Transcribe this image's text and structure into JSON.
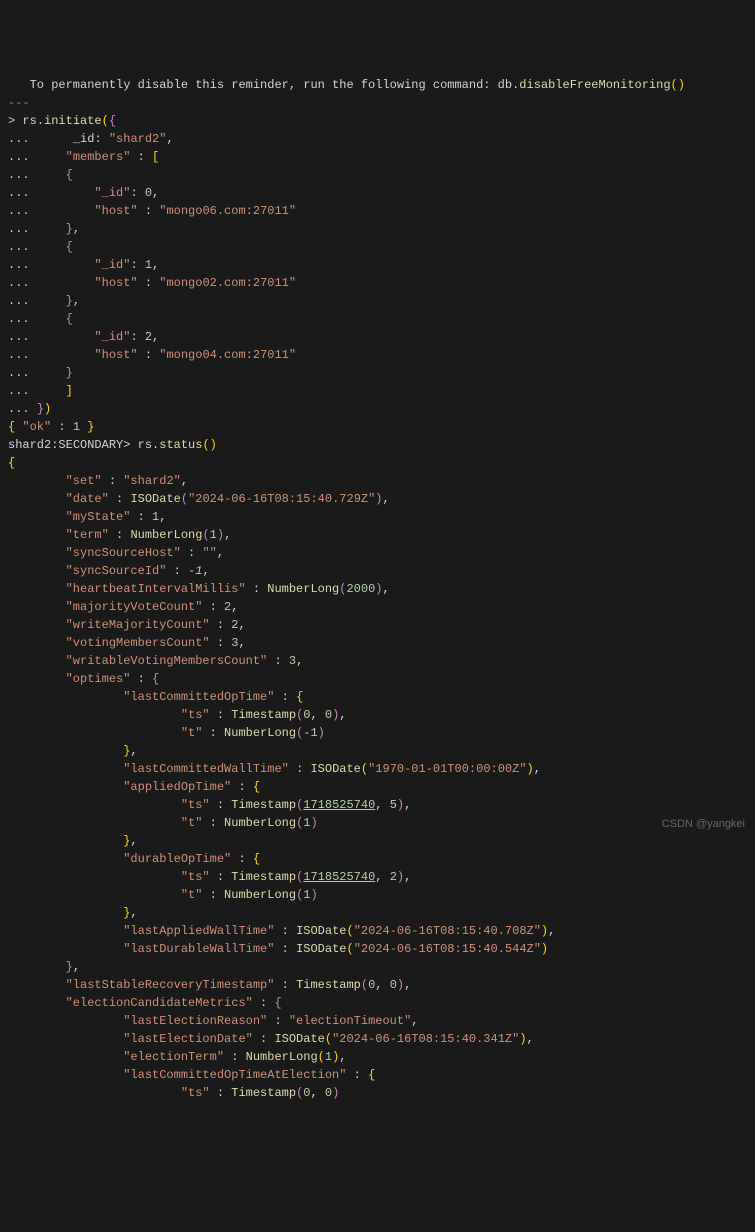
{
  "line1": {
    "text1": "   To permanently disable this reminder, run the following command",
    "colon": ":",
    "db": " db",
    "dot": ".",
    "fn": "disableFreeMonitoring",
    "parens": "()"
  },
  "dashes": "---",
  "prompt": {
    "gt": ">",
    "rs": " rs",
    "dot": ".",
    "initiate": "initiate",
    "paren_open": "(",
    "brace_open": "{"
  },
  "initiate": {
    "line_continue": "...",
    "id_key": "_id",
    "shard2": "\"shard2\"",
    "members_key": "\"members\"",
    "bracket_open": "[",
    "brace_open": "{",
    "id_0": "0",
    "id_1": "1",
    "id_2": "2",
    "host_key": "\"host\"",
    "host0": "\"mongo06.com:27011\"",
    "host1": "\"mongo02.com:27011\"",
    "host2": "\"mongo04.com:27011\"",
    "brace_close": "}",
    "bracket_close": "]",
    "paren_close": ")"
  },
  "ok_line": {
    "brace_open": "{",
    "ok_key": "\"ok\"",
    "colon": " : ",
    "val": "1",
    "brace_close": " }"
  },
  "status_prompt": {
    "shard": "shard2",
    "colon": ":",
    "secondary": "SECONDARY",
    "gt": ">",
    "rs": " rs",
    "dot": ".",
    "status": "status",
    "parens": "()"
  },
  "status": {
    "set_key": "\"set\"",
    "set_val": "\"shard2\"",
    "date_key": "\"date\"",
    "isodate": "ISODate",
    "date_val": "\"2024-06-16T08:15:40.729Z\"",
    "mystate_key": "\"myState\"",
    "mystate_val": "1",
    "term_key": "\"term\"",
    "numberlong": "NumberLong",
    "term_val": "1",
    "syncsourcehost_key": "\"syncSourceHost\"",
    "empty": "\"\"",
    "syncsourceid_key": "\"syncSourceId\"",
    "neg1": "-1",
    "heartbeat_key": "\"heartbeatIntervalMillis\"",
    "heartbeat_val": "2000",
    "majorityvote_key": "\"majorityVoteCount\"",
    "val2": "2",
    "writemajority_key": "\"writeMajorityCount\"",
    "votingmembers_key": "\"votingMembersCount\"",
    "val3": "3",
    "writablevoting_key": "\"writableVotingMembersCount\"",
    "optimes_key": "\"optimes\"",
    "lastcommitted_key": "\"lastCommittedOpTime\"",
    "ts_key": "\"ts\"",
    "timestamp": "Timestamp",
    "ts_0_0": "0, 0",
    "t_key": "\"t\"",
    "t_neg1": "-1",
    "lastcommittedwall_key": "\"lastCommittedWallTime\"",
    "epoch": "\"1970-01-01T00:00:00Z\"",
    "appliedoptime_key": "\"appliedOpTime\"",
    "ts_1718_5": "1718525740",
    "ts_5": "5",
    "t_1": "1",
    "durableoptime_key": "\"durableOpTime\"",
    "ts_2": "2",
    "lastapplied_key": "\"lastAppliedWallTime\"",
    "lastapplied_val": "\"2024-06-16T08:15:40.708Z\"",
    "lastdurable_key": "\"lastDurableWallTime\"",
    "lastdurable_val": "\"2024-06-16T08:15:40.544Z\"",
    "laststable_key": "\"lastStableRecoveryTimestamp\"",
    "electioncandidate_key": "\"electionCandidateMetrics\"",
    "lastelectionreason_key": "\"lastElectionReason\"",
    "electiontimeout": "\"electionTimeout\"",
    "lastelectiondate_key": "\"lastElectionDate\"",
    "lastelectiondate_val": "\"2024-06-16T08:15:40.341Z\"",
    "electionterm_key": "\"electionTerm\"",
    "lastcommittedoptime_key": "\"lastCommittedOpTimeAtElection\""
  },
  "watermark": "CSDN @yangkei"
}
